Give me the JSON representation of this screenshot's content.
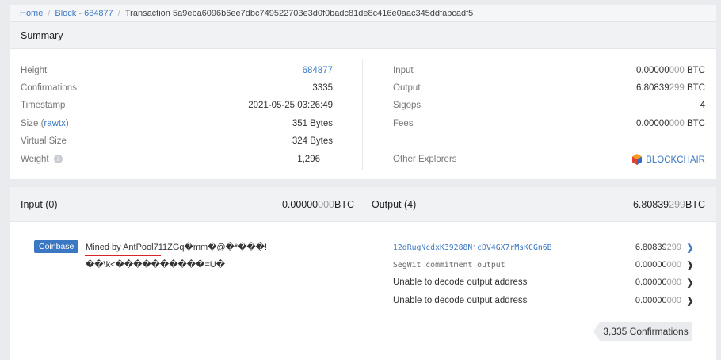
{
  "breadcrumb": {
    "home": "Home",
    "block": "Block - 684877",
    "current": "Transaction 5a9eba6096b6ee7dbc749522703e3d0f0badc81de8c416e0aac345ddfabcadf5"
  },
  "summary": {
    "title": "Summary",
    "left": [
      {
        "label": "Height",
        "value": "684877"
      },
      {
        "label": "Confirmations",
        "value": "3335"
      },
      {
        "label": "Timestamp",
        "value": "2021-05-25 03:26:49"
      },
      {
        "label": "Size",
        "link": "rawtx",
        "value": "351 Bytes"
      },
      {
        "label": "Virtual Size",
        "value": "324 Bytes"
      },
      {
        "label": "Weight",
        "value": "1,296"
      }
    ],
    "right": [
      {
        "label": "Input",
        "value_main": "0.00000",
        "value_dim": "000",
        "unit": " BTC"
      },
      {
        "label": "Output",
        "value_main": "6.80839",
        "value_dim": "299",
        "unit": " BTC"
      },
      {
        "label": "Sigops",
        "value": "4"
      },
      {
        "label": "Fees",
        "value_main": "0.00000",
        "value_dim": "000",
        "unit": " BTC"
      }
    ],
    "other_explorers": {
      "label": "Other Explorers",
      "link": "BLOCKCHAIR"
    }
  },
  "io": {
    "input_header": "Input (0)",
    "input_total_main": "0.00000",
    "input_total_dim": "000",
    "input_total_unit": " BTC",
    "output_header": "Output (4)",
    "output_total_main": "6.80839",
    "output_total_dim": "299",
    "output_total_unit": " BTC",
    "coinbase_badge": "Coinbase",
    "coinbase_line1": "Mined by AntPool711ZGq�mm�@�*���!",
    "coinbase_line2": "��\\k<����������=U�",
    "outputs": [
      {
        "address": "12dRugNcdxK39288NjcDV4GX7rMsKCGn6B",
        "amount_main": "6.80839",
        "amount_dim": "299"
      },
      {
        "address": "SegWit commitment output",
        "amount_main": "0.00000",
        "amount_dim": "000"
      },
      {
        "address": "Unable to decode output address",
        "amount_main": "0.00000",
        "amount_dim": "000"
      },
      {
        "address": "Unable to decode output address",
        "amount_main": "0.00000",
        "amount_dim": "000"
      }
    ],
    "confirmations": "3,335 Confirmations"
  }
}
